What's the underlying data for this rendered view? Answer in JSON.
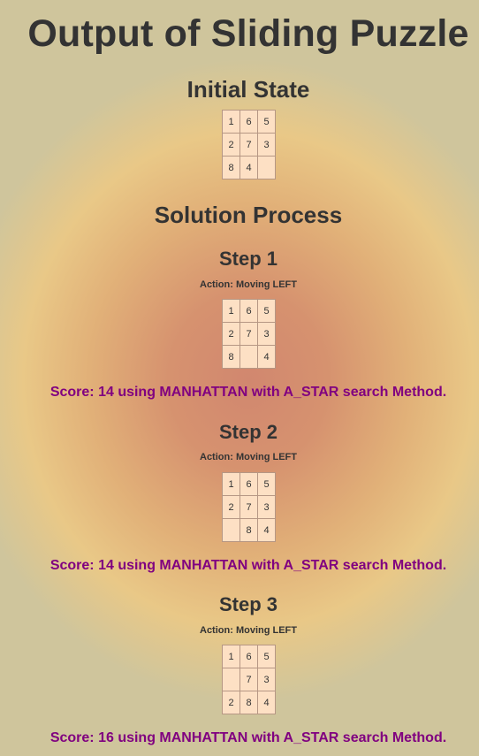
{
  "title": "Output of Sliding Puzzle",
  "initial": {
    "heading": "Initial State",
    "board": [
      [
        "1",
        "6",
        "5"
      ],
      [
        "2",
        "7",
        "3"
      ],
      [
        "8",
        "4",
        ""
      ]
    ]
  },
  "process_heading": "Solution Process",
  "steps": [
    {
      "heading": "Step 1",
      "action": "Action: Moving LEFT",
      "board": [
        [
          "1",
          "6",
          "5"
        ],
        [
          "2",
          "7",
          "3"
        ],
        [
          "8",
          "",
          "4"
        ]
      ],
      "score": "Score: 14 using MANHATTAN with A_STAR search Method."
    },
    {
      "heading": "Step 2",
      "action": "Action: Moving LEFT",
      "board": [
        [
          "1",
          "6",
          "5"
        ],
        [
          "2",
          "7",
          "3"
        ],
        [
          "",
          "8",
          "4"
        ]
      ],
      "score": "Score: 14 using MANHATTAN with A_STAR search Method."
    },
    {
      "heading": "Step 3",
      "action": "Action: Moving LEFT",
      "board": [
        [
          "1",
          "6",
          "5"
        ],
        [
          "",
          "7",
          "3"
        ],
        [
          "2",
          "8",
          "4"
        ]
      ],
      "score": "Score: 16 using MANHATTAN with A_STAR search Method."
    }
  ]
}
